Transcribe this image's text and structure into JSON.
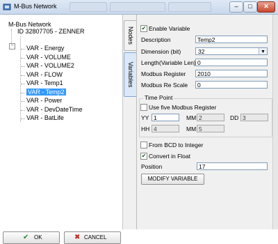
{
  "window": {
    "title": "M-Bus Network"
  },
  "tree": {
    "root": "M-Bus Network",
    "device": "ID 32807705 - ZENNER",
    "expander_glyph": "−",
    "variables": [
      {
        "label": "VAR - Energy",
        "selected": false
      },
      {
        "label": "VAR - VOLUME",
        "selected": false
      },
      {
        "label": "VAR - VOLUME2",
        "selected": false
      },
      {
        "label": "VAR - FLOW",
        "selected": false
      },
      {
        "label": "VAR - Temp1",
        "selected": false
      },
      {
        "label": "VAR - Temp2",
        "selected": true
      },
      {
        "label": "VAR - Power",
        "selected": false
      },
      {
        "label": "VAR - DevDateTime",
        "selected": false
      },
      {
        "label": "VAR - BatLife",
        "selected": false
      }
    ]
  },
  "buttons": {
    "ok": "OK",
    "cancel": "CANCEL",
    "ok_icon": "✔",
    "cancel_icon": "✖"
  },
  "tabs": {
    "nodes": "Nodes",
    "variables": "Variables",
    "active": "variables"
  },
  "form": {
    "enable_variable": {
      "label": "Enable Variable",
      "checked": true
    },
    "description": {
      "label": "Description",
      "value": "Temp2"
    },
    "dimension": {
      "label": "Dimension (bit)",
      "value": "32"
    },
    "length": {
      "label": "Length(Variable Len)",
      "value": "0"
    },
    "modbus_register": {
      "label": "Modbus Register",
      "value": "2010"
    },
    "modbus_re_scale": {
      "label": "Modbus Re Scale",
      "value": "0"
    },
    "time_point": {
      "title": "Time Point",
      "use_five": {
        "label": "Use five Modbus Register",
        "checked": false
      },
      "yy": {
        "label": "YY",
        "value": "1"
      },
      "mm": {
        "label": "MM",
        "value": "2"
      },
      "dd": {
        "label": "DD",
        "value": "3"
      },
      "hh": {
        "label": "HH",
        "value": "4"
      },
      "min": {
        "label": "MM",
        "value": "5"
      }
    },
    "from_bcd": {
      "label": "From BCD to Integer",
      "checked": false
    },
    "convert_float": {
      "label": "Convert in Float",
      "checked": true
    },
    "position": {
      "label": "Position",
      "value": "17"
    },
    "modify_button": "MODIFY VARIABLE"
  },
  "colors": {
    "selection": "#3399ff",
    "check": "#1a5a1a",
    "field_border": "#7f9db9"
  },
  "window_buttons": {
    "minimize": "–",
    "maximize": "□",
    "close": "✕"
  }
}
